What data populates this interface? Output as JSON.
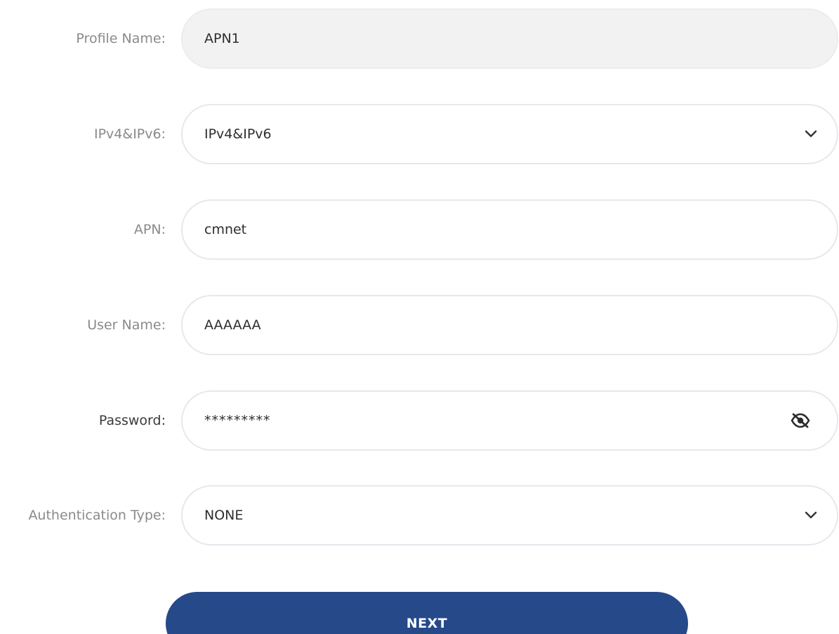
{
  "form": {
    "profile_name": {
      "label": "Profile Name:",
      "value": "APN1"
    },
    "ip_type": {
      "label": "IPv4&IPv6:",
      "value": "IPv4&IPv6",
      "icon": "chevron-down-icon"
    },
    "apn": {
      "label": "APN:",
      "value": "cmnet"
    },
    "user_name": {
      "label": "User Name:",
      "value": "AAAAAA"
    },
    "password": {
      "label": "Password:",
      "value": "*********",
      "icon": "eye-slash-icon"
    },
    "auth_type": {
      "label": "Authentication Type:",
      "value": "NONE",
      "icon": "chevron-down-icon"
    }
  },
  "actions": {
    "next_label": "NEXT"
  },
  "colors": {
    "primary": "#26498a",
    "field_border": "#e7e8ee",
    "disabled_bg": "#f2f2f2",
    "label": "#8a8a8a"
  }
}
